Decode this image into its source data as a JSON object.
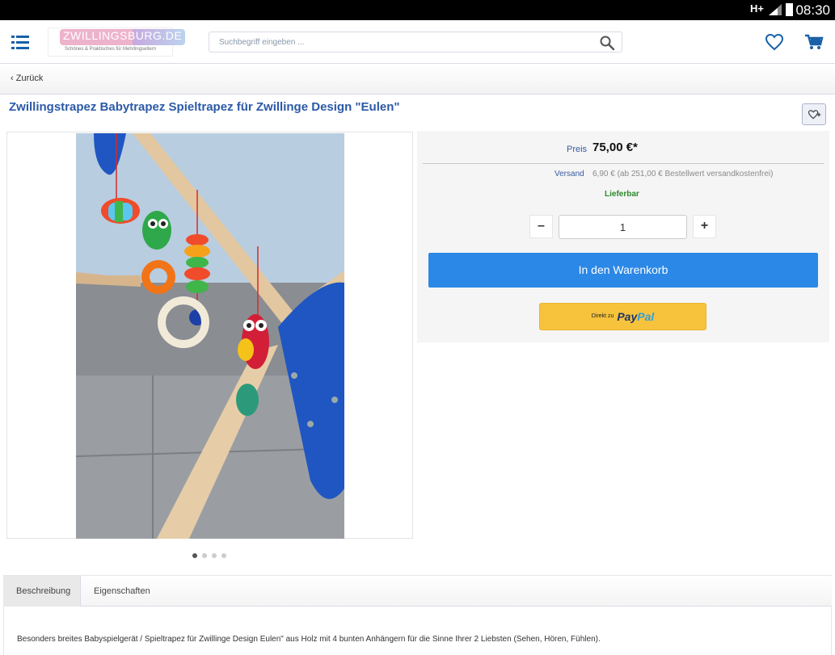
{
  "status": {
    "network": "H+",
    "time": "08:30"
  },
  "header": {
    "logo_text": "ZWILLINGSBURG.DE",
    "logo_tagline": "Schönes & Praktisches für Mehrlingseltern",
    "search_placeholder": "Suchbegriff eingeben ..."
  },
  "nav": {
    "back_label": "Zurück"
  },
  "product": {
    "title": "Zwillingstrapez Babytrapez Spieltrapez für Zwillinge Design \"Eulen\"",
    "price_label": "Preis",
    "price": "75,00 €*",
    "shipping_label": "Versand",
    "shipping": "6,90 € (ab 251,00 € Bestellwert versandkostenfrei)",
    "availability": "Lieferbar",
    "quantity": "1",
    "minus_label": "–",
    "plus_label": "+",
    "add_to_cart": "In den Warenkorb",
    "paypal_prefix": "Direkt zu",
    "paypal_word1": "Pay",
    "paypal_word2": "Pal"
  },
  "tabs": [
    {
      "label": "Beschreibung"
    },
    {
      "label": "Eigenschaften"
    }
  ],
  "description": "Besonders breites Babyspielgerät / Spieltrapez für Zwillinge Design Eulen\" aus Holz mit 4 bunten Anhängern für die Sinne Ihrer 2 Liebsten (Sehen, Hören, Fühlen).",
  "colors": {
    "accent": "#2b88e7",
    "title": "#2b5aa7",
    "available": "#2c8a2c",
    "paypal": "#f7c33c"
  }
}
